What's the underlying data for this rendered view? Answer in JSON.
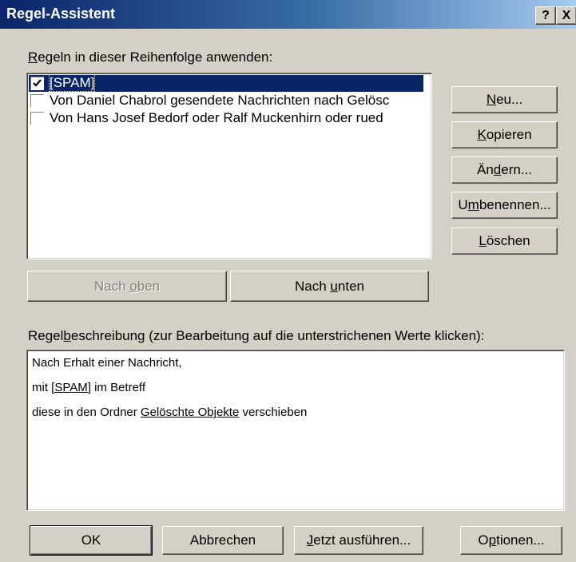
{
  "window": {
    "title": "Regel-Assistent",
    "help_glyph": "?",
    "close_glyph": "X"
  },
  "rules_section": {
    "label_pre": "",
    "label_accel": "R",
    "label_post": "egeln in dieser Reihenfolge anwenden:",
    "rules": [
      {
        "label": "[SPAM]",
        "checked": true,
        "selected": true
      },
      {
        "label": "Von Daniel Chabrol gesendete Nachrichten nach Gelösc",
        "checked": false,
        "selected": false
      },
      {
        "label": "Von Hans Josef Bedorf oder Ralf Muckenhirn oder rued",
        "checked": false,
        "selected": false
      }
    ]
  },
  "side_buttons": {
    "new": {
      "pre": "",
      "accel": "N",
      "post": "eu..."
    },
    "copy": {
      "pre": "",
      "accel": "K",
      "post": "opieren"
    },
    "change": {
      "pre": "Än",
      "accel": "d",
      "post": "ern..."
    },
    "rename": {
      "pre": "U",
      "accel": "m",
      "post": "benennen..."
    },
    "delete": {
      "pre": "",
      "accel": "L",
      "post": "öschen"
    }
  },
  "order_buttons": {
    "up": {
      "pre": "Nach ",
      "accel": "o",
      "post": "ben",
      "enabled": false
    },
    "down": {
      "pre": "Nach ",
      "accel": "u",
      "post": "nten",
      "enabled": true
    }
  },
  "description": {
    "label_pre": "Regel",
    "label_accel": "b",
    "label_post": "eschreibung (zur Bearbeitung auf die unterstrichenen Werte klicken):",
    "line1": "Nach Erhalt einer Nachricht,",
    "line2_pre": "mit ",
    "line2_link": "[SPAM]",
    "line2_post": " im Betreff",
    "line3_pre": "diese in den Ordner ",
    "line3_link": "Gelöschte Objekte",
    "line3_post": " verschieben"
  },
  "footer_buttons": {
    "ok": {
      "label": "OK"
    },
    "cancel": {
      "label": "Abbrechen"
    },
    "run": {
      "pre": "",
      "accel": "J",
      "post": "etzt ausführen..."
    },
    "options": {
      "pre": "O",
      "accel": "p",
      "post": "tionen..."
    }
  }
}
